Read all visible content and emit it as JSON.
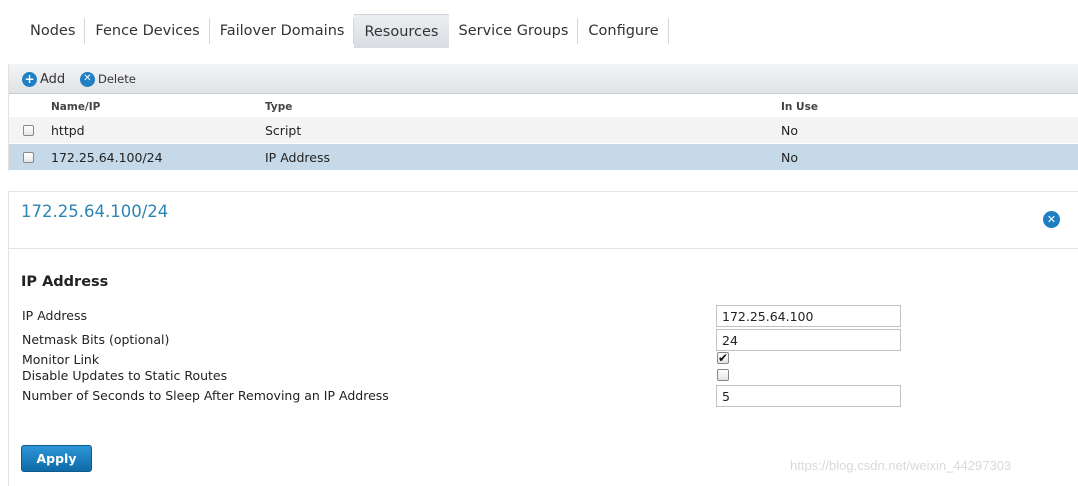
{
  "tabs": [
    {
      "label": "Nodes",
      "active": false
    },
    {
      "label": "Fence Devices",
      "active": false
    },
    {
      "label": "Failover Domains",
      "active": false
    },
    {
      "label": "Resources",
      "active": true
    },
    {
      "label": "Service Groups",
      "active": false
    },
    {
      "label": "Configure",
      "active": false
    }
  ],
  "toolbar": {
    "add_label": "Add",
    "delete_label": "Delete",
    "add_icon": "plus-circle-icon",
    "delete_icon": "x-circle-icon"
  },
  "table": {
    "columns": [
      "Name/IP",
      "Type",
      "In Use"
    ],
    "rows": [
      {
        "name": "httpd",
        "type": "Script",
        "in_use": "No",
        "selected": false
      },
      {
        "name": "172.25.64.100/24",
        "type": "IP Address",
        "in_use": "No",
        "selected": true
      }
    ]
  },
  "detail": {
    "title": "172.25.64.100/24",
    "section_title": "IP Address",
    "fields": {
      "ip_address": {
        "label": "IP Address",
        "value": "172.25.64.100"
      },
      "netmask": {
        "label": "Netmask Bits (optional)",
        "value": "24"
      },
      "monitor_link": {
        "label": "Monitor Link",
        "checked": true
      },
      "disable_updates": {
        "label": "Disable Updates to Static Routes",
        "checked": false
      },
      "sleep_seconds": {
        "label": "Number of Seconds to Sleep After Removing an IP Address",
        "value": "5"
      }
    },
    "apply_label": "Apply"
  },
  "watermark": "https://blog.csdn.net/weixin_44297303",
  "colors": {
    "accent": "#1f7fc2",
    "selected_row": "#c5d9e8",
    "title_blue": "#2a86b5"
  }
}
